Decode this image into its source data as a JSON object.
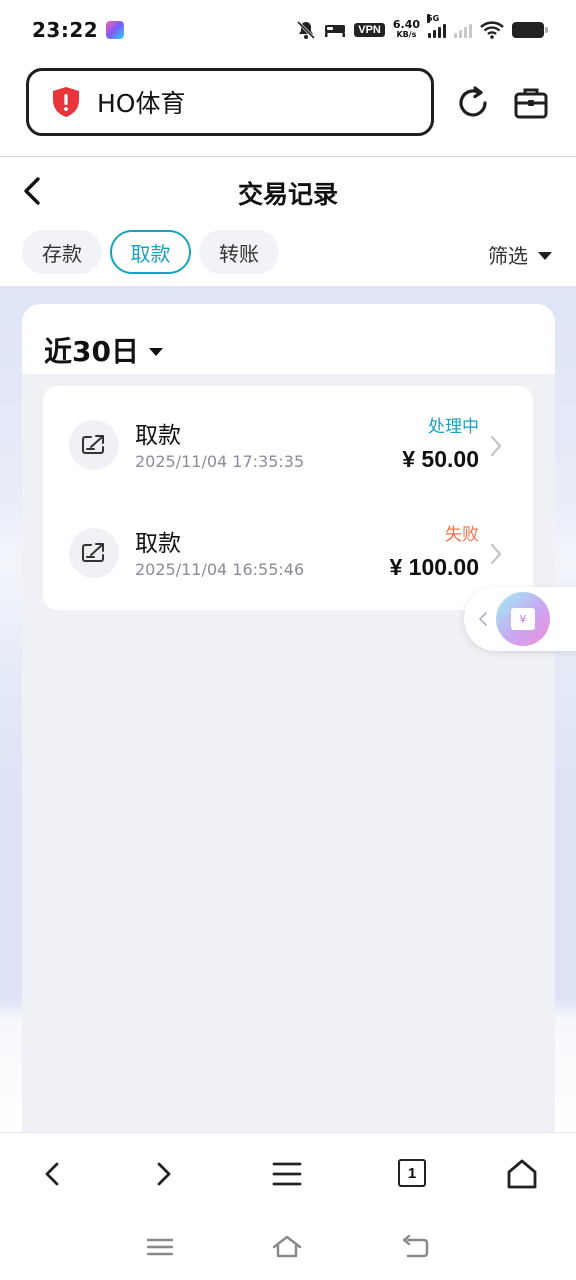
{
  "status_bar": {
    "time": "23:22",
    "vpn": "VPN",
    "speed_value": "6.40",
    "speed_unit": "KB/s",
    "network": "5G"
  },
  "browser": {
    "url_text": "HO体育",
    "tab_count": "1"
  },
  "header": {
    "title": "交易记录"
  },
  "tabs": [
    {
      "label": "存款",
      "active": false
    },
    {
      "label": "取款",
      "active": true
    },
    {
      "label": "转账",
      "active": false
    }
  ],
  "filter": {
    "label": "筛选"
  },
  "period": {
    "label": "近30日"
  },
  "records": [
    {
      "type": "取款",
      "time": "2025/11/04 17:35:35",
      "status": "处理中",
      "status_color": "#16a3c0",
      "amount": "¥ 50.00"
    },
    {
      "type": "取款",
      "time": "2025/11/04 16:55:46",
      "status": "失败",
      "status_color": "#f0704a",
      "amount": "¥ 100.00"
    }
  ],
  "float_widget": {
    "symbol": "¥"
  },
  "colors": {
    "accent": "#16a3c0",
    "processing": "#16a3c0",
    "failed": "#f0704a"
  }
}
